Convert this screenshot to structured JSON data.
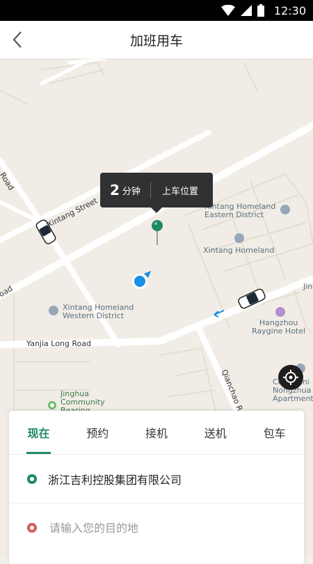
{
  "status_bar": {
    "time": "12:30",
    "icons": [
      "wifi-icon",
      "signal-icon",
      "battery-icon"
    ]
  },
  "header": {
    "title": "加班用车",
    "back_icon": "chevron-left-icon"
  },
  "map": {
    "labels": {
      "xintang_street": "Xintang Street",
      "road_left_top": "Road",
      "road_left_mid": "oad",
      "xintang_homeland_east_1": "Xintang Homeland",
      "xintang_homeland_east_2": "Eastern District",
      "xintang_homeland": "Xintang Homeland",
      "xintang_homeland_west_1": "Xintang Homeland",
      "xintang_homeland_west_2": "Western District",
      "yanjia_long_road": "Yanjia Long Road",
      "qianchao_road": "Qianchao R",
      "hangzhou_raygine_1": "Hangzhou",
      "hangzhou_raygine_2": "Raygine Hotel",
      "jinghua_1": "Jinghua",
      "jinghua_2": "Community",
      "jinghua_3": "Bearing",
      "nongzhua_1": "Communi",
      "nongzhua_2": "Nongzhua",
      "nongzhua_3": "Apartment",
      "jin_partial": "Jin"
    },
    "eta": {
      "number": "2",
      "unit": "分钟",
      "pickup_label": "上车位置"
    }
  },
  "tabs": [
    {
      "label": "现在",
      "active": true
    },
    {
      "label": "预约",
      "active": false
    },
    {
      "label": "接机",
      "active": false
    },
    {
      "label": "送机",
      "active": false
    },
    {
      "label": "包车",
      "active": false
    }
  ],
  "origin": {
    "value": "浙江吉利控股集团有限公司"
  },
  "destination": {
    "placeholder": "请输入您的目的地"
  },
  "colors": {
    "accent": "#1e8a64",
    "destination_dot": "#d15c5c",
    "tooltip_bg": "#2f3133",
    "user_dot": "#1a8fe3"
  }
}
